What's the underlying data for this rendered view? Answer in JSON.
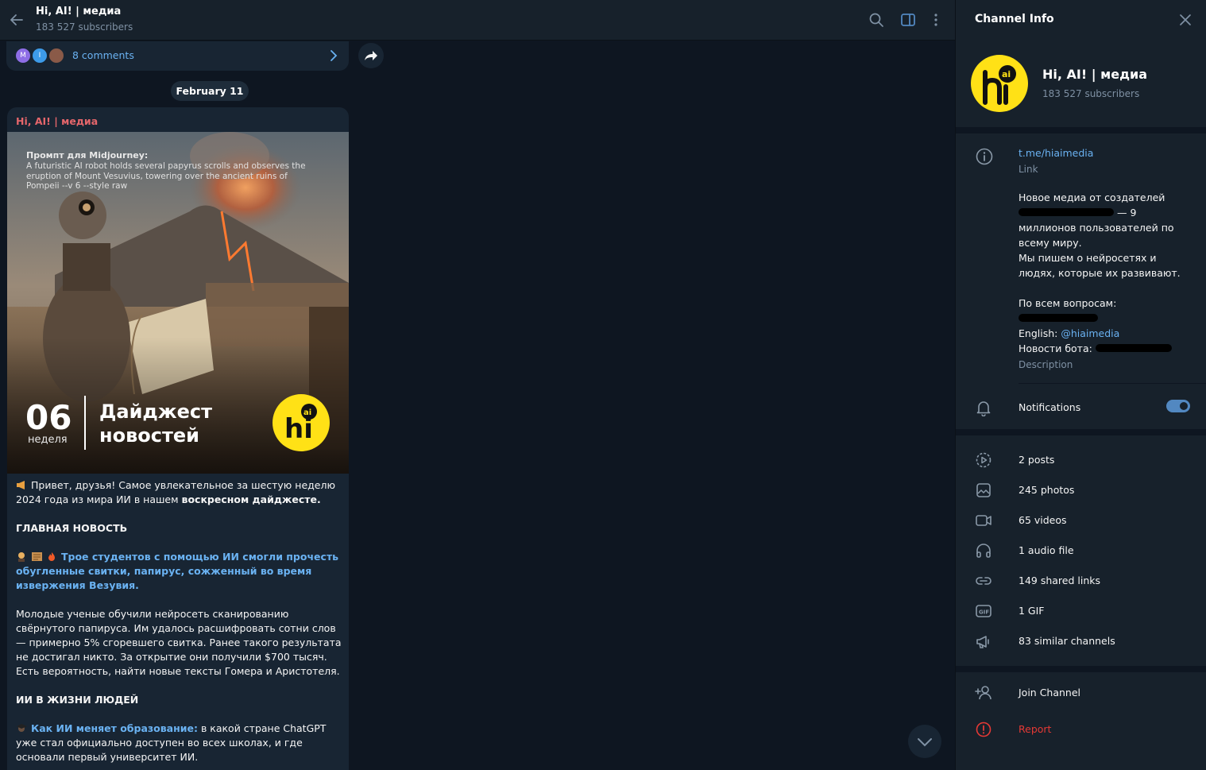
{
  "header": {
    "title": "Hi, AI! | медиа",
    "subtitle": "183 527 subscribers"
  },
  "comments": {
    "avatars": [
      "M",
      "I",
      ""
    ],
    "label": "8 comments"
  },
  "date_pill": "February 11",
  "post": {
    "author": "Hi, AI! | медиа",
    "image": {
      "prompt_title": "Промпт для Midjourney:",
      "prompt_text": "A futuristic AI robot holds several papyrus scrolls and observes the eruption of Mount Vesuvius, towering over the ancient ruins of Pompeii --v 6 --style raw",
      "week_number": "06",
      "week_label": "неделя",
      "digest_line1": "Дайджест",
      "digest_line2": "новостей",
      "logo_text": "hi",
      "logo_badge": "ai"
    },
    "intro_text": "Привет, друзья! Самое увлекательное за шестую неделю 2024 года из мира ИИ в нашем ",
    "intro_bold": "воскресном дайджесте.",
    "heading_main": "ГЛАВНАЯ НОВОСТЬ",
    "main_link": "Трое студентов с помощью ИИ смогли прочесть обугленные свитки, папирус, сожженный во время извержения Везувия.",
    "main_paragraph": "Молодые ученые обучили нейросеть сканированию свёрнутого папируса. Им удалось расшифровать сотни слов — примерно 5% сгоревшего свитка. Ранее такого результата не достигал никто. За открытие они получили $700 тысяч. Есть вероятность, найти новые тексты Гомера и Аристотеля.",
    "heading_life": "ИИ В ЖИЗНИ ЛЮДЕЙ",
    "life_link": "Как ИИ меняет образование:",
    "life_text": " в какой стране ChatGPT уже стал официально доступен во всех школах, и где основали первый университет ИИ."
  },
  "panel": {
    "title": "Channel Info",
    "name": "Hi, AI! | медиа",
    "subscribers": "183 527 subscribers",
    "link": "t.me/hiaimedia",
    "link_caption": "Link",
    "desc_line1": "Новое медиа от создателей",
    "desc_after_redact": " — 9 миллионов  пользователей по всему миру.",
    "desc_line3": "Мы пишем о нейросетях и людях, которые их развивают.",
    "desc_questions": "По всем вопросам:",
    "desc_english": "English: ",
    "desc_english_handle": "@hiaimedia",
    "desc_news": "Новости бота: ",
    "desc_caption": "Description",
    "notifications_label": "Notifications",
    "notifications_on": true,
    "media": [
      {
        "icon": "video-circle-icon",
        "label": "2 posts"
      },
      {
        "icon": "photo-icon",
        "label": "245 photos"
      },
      {
        "icon": "video-camera-icon",
        "label": "65 videos"
      },
      {
        "icon": "headphones-icon",
        "label": "1 audio file"
      },
      {
        "icon": "link-icon",
        "label": "149 shared links"
      },
      {
        "icon": "gif-icon",
        "label": "1 GIF"
      },
      {
        "icon": "megaphone-icon",
        "label": "83 similar channels"
      }
    ],
    "join_label": "Join Channel",
    "report_label": "Report"
  },
  "colors": {
    "background": "#0e1621",
    "panel": "#17212b",
    "bubble": "#182533",
    "accent": "#6ab2f2",
    "author": "#e5666b",
    "danger": "#e53935",
    "brand_yellow": "#ffe116"
  }
}
